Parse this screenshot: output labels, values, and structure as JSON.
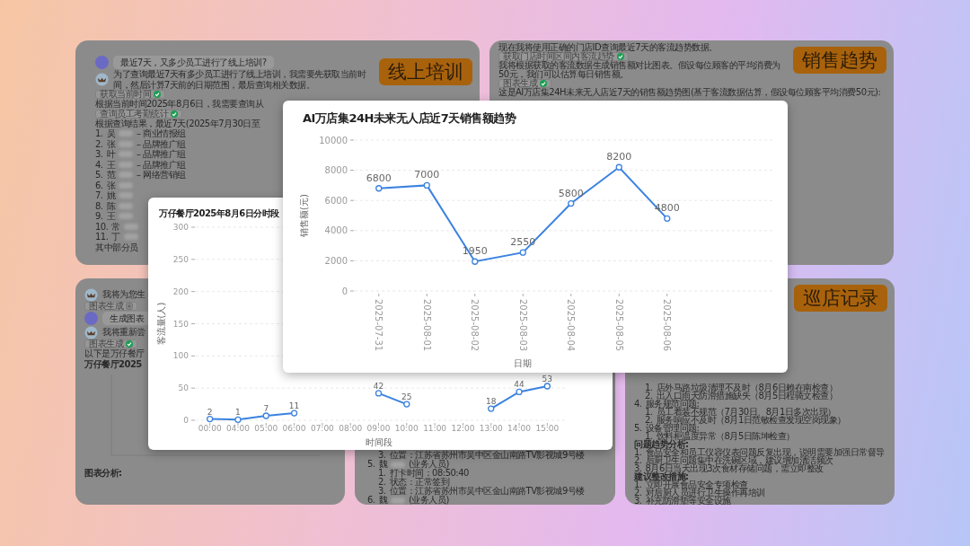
{
  "panels": [
    {
      "label": "线上培训",
      "items": [
        {
          "kind": "user",
          "text": "最近7天，又多少员工进行了线上培训?"
        },
        {
          "kind": "bot",
          "text": "为了查询最近7天有多少员工进行了线上培训，我需要先获取当前时间，然后计算7天前的日期范围，最后查询相关数据。"
        },
        {
          "kind": "badge",
          "text": "获取当前时间",
          "done": true
        },
        {
          "kind": "text",
          "text": "根据当前时间2025年8月6日，我需要查询从"
        },
        {
          "kind": "badge",
          "text": "查询员工考勤统计",
          "done": true
        },
        {
          "kind": "text",
          "text": "根据查询结果，最近7天(2025年7月30日至"
        },
        {
          "kind": "item",
          "num": "1.",
          "name": "吴",
          "text": "– 商业情报组"
        },
        {
          "kind": "item",
          "num": "2.",
          "name": "张",
          "text": "– 品牌推广组"
        },
        {
          "kind": "item",
          "num": "3.",
          "name": "叶",
          "text": "– 品牌推广组"
        },
        {
          "kind": "item",
          "num": "4.",
          "name": "王",
          "text": "– 品牌推广组"
        },
        {
          "kind": "item",
          "num": "5.",
          "name": "范",
          "text": "– 网络营销组"
        },
        {
          "kind": "item",
          "num": "6.",
          "name": "张"
        },
        {
          "kind": "item",
          "num": "7.",
          "name": "姚"
        },
        {
          "kind": "item",
          "num": "8.",
          "name": "陈"
        },
        {
          "kind": "item",
          "num": "9.",
          "name": "王"
        },
        {
          "kind": "item",
          "num": "10.",
          "name": "常"
        },
        {
          "kind": "item",
          "num": "11.",
          "name": "丁"
        },
        {
          "kind": "text",
          "text": "其中部分员"
        }
      ]
    },
    {
      "label": "销售趋势",
      "items": [
        {
          "kind": "text",
          "text": "现在我将使用正确的门店ID查询最近7天的客流趋势数据。"
        },
        {
          "kind": "badge",
          "text": "获取门店时间区间内客流趋势",
          "done": true
        },
        {
          "kind": "text",
          "text": "我将根据获取的客流数据生成销售额对比图表。假设每位顾客的平均消费为50元，我们可以估算每日销售额。"
        },
        {
          "kind": "badge",
          "text": "图表生成",
          "done": true
        },
        {
          "kind": "text",
          "text": "这是AI万店集24H未来无人店近7天的销售额趋势图(基于客流数据估算，假设每位顾客平均消费50元):"
        }
      ]
    },
    {
      "items": [
        {
          "kind": "bot",
          "text": "我将为您生"
        },
        {
          "kind": "badge",
          "text": "图表生成",
          "done": false
        },
        {
          "kind": "user",
          "text": "生成图表"
        },
        {
          "kind": "bot",
          "text": "我将重新尝"
        },
        {
          "kind": "badge",
          "text": "图表生成",
          "done": true
        },
        {
          "kind": "text",
          "text": "以下是万仔餐厅"
        },
        {
          "kind": "chart",
          "text": "万仔餐厅2025"
        },
        {
          "kind": "heading",
          "text": "图表分析:"
        }
      ]
    },
    {
      "items": [
        {
          "kind": "item",
          "children": [
            {
              "kind": "item",
              "num": "3.",
              "text": "位置：江苏省苏州市吴中区金山南路TV影视城9号楼"
            }
          ]
        },
        {
          "kind": "item",
          "num": "5.",
          "name": "魏",
          "text": "(业务人员)",
          "children": [
            {
              "kind": "item",
              "num": "1.",
              "text": "打卡时间：08:50:40"
            },
            {
              "kind": "item",
              "num": "2.",
              "text": "状态：正常签到"
            },
            {
              "kind": "item",
              "num": "3.",
              "text": "位置：江苏省苏州市吴中区金山南路TV影视城9号楼"
            }
          ]
        },
        {
          "kind": "item",
          "num": "6.",
          "name": "魏",
          "text": "(业务人员)"
        }
      ]
    },
    {
      "label": "巡店记录",
      "items": [
        {
          "kind": "item",
          "children": [
            {
              "kind": "item",
              "num": "1.",
              "text": "店外马路垃圾清理不及时（8月6日赖在南检查）"
            },
            {
              "kind": "item",
              "num": "2.",
              "text": "出入口雨天防滑措施缺失（8月5日程骑文检查）"
            }
          ]
        },
        {
          "kind": "item",
          "num": "4.",
          "text": "服务规范问题:",
          "children": [
            {
              "kind": "item",
              "num": "1.",
              "text": "员工着装不规范（7月30日、8月1日多次出现）"
            },
            {
              "kind": "item",
              "num": "2.",
              "text": "服务响应不及时（8月1日范敏检查发现空岗现象）"
            }
          ]
        },
        {
          "kind": "item",
          "num": "5.",
          "text": "设备管理问题:",
          "children": [
            {
              "kind": "item",
              "num": "1.",
              "text": "饮料柜温度异常（8月5日陈坤检查）"
            }
          ]
        },
        {
          "kind": "heading",
          "text": "问题趋势分析:"
        },
        {
          "kind": "item",
          "num": "1.",
          "text": "食品安全和员工仪容仪表问题反复出现，说明需要加强日常督导"
        },
        {
          "kind": "item",
          "num": "2.",
          "text": "后厨卫生问题集中在洗碗区域，建议增加清洁频次"
        },
        {
          "kind": "item",
          "num": "3.",
          "text": "8月6日当天出现3次食材存储问题，需立即整改"
        },
        {
          "kind": "heading",
          "text": "建议整改措施:"
        },
        {
          "kind": "item",
          "num": "1.",
          "text": "立即开展食品安全专项检查"
        },
        {
          "kind": "item",
          "num": "2.",
          "text": "对后厨人员进行卫生操作再培训"
        },
        {
          "kind": "item",
          "num": "3.",
          "text": "补充防滑垫等安全设施"
        }
      ]
    }
  ],
  "sales_card": {
    "chart_data": {
      "type": "line",
      "title": "AI万店集24H未来无人店近7天销售额趋势",
      "xlabel": "日期",
      "ylabel": "销售额(元)",
      "categories": [
        "2025-07-31",
        "2025-08-01",
        "2025-08-02",
        "2025-08-03",
        "2025-08-04",
        "2025-08-05",
        "2025-08-06"
      ],
      "series": [
        {
          "color": "#3b82e0",
          "marker": true,
          "values": [
            6800,
            7000,
            1950,
            2550,
            5800,
            8200,
            4800
          ]
        }
      ],
      "ylim": [
        0,
        10000
      ],
      "yticks": [
        0,
        2000,
        4000,
        6000,
        8000,
        10000
      ],
      "grid": true,
      "data_labels": true
    }
  },
  "traffic_card": {
    "chart_data": {
      "type": "line",
      "title": "万仔餐厅2025年8月6日分时段",
      "xlabel": "时间段",
      "ylabel": "客流量(人)",
      "categories": [
        "00:00",
        "04:00",
        "05:00",
        "06:00",
        "07:00",
        "08:00",
        "09:00",
        "10:00",
        "11:00",
        "12:00",
        "13:00",
        "14:00",
        "15:00"
      ],
      "series": [
        {
          "color": "#3b82e0",
          "marker": true,
          "values": [
            2,
            1,
            7,
            11,
            null,
            null,
            42,
            25,
            null,
            null,
            18,
            44,
            53
          ]
        }
      ],
      "ylim": [
        0,
        300
      ],
      "yticks": [
        0,
        50,
        100,
        150,
        200,
        250,
        300
      ],
      "grid": true,
      "data_labels": true
    }
  }
}
